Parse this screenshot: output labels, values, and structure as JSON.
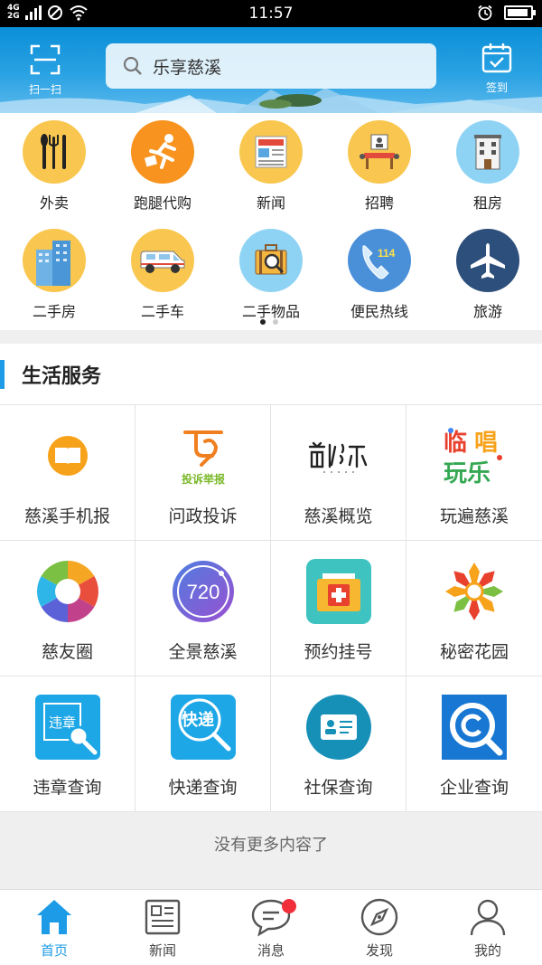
{
  "status_bar": {
    "network_top": "4G",
    "network_bottom": "2G",
    "time": "11:57",
    "battery_level": 0.85
  },
  "header": {
    "scan_label": "扫一扫",
    "search_text": "乐享慈溪",
    "checkin_label": "签到"
  },
  "quick_items": [
    {
      "label": "外卖",
      "icon": "food-icon",
      "color": "#f9c74f"
    },
    {
      "label": "跑腿代购",
      "icon": "runner-icon",
      "color": "#f7931e"
    },
    {
      "label": "新闻",
      "icon": "newspaper-icon",
      "color": "#f9c74f"
    },
    {
      "label": "招聘",
      "icon": "recruit-icon",
      "color": "#f9c74f"
    },
    {
      "label": "租房",
      "icon": "building-icon",
      "color": "#8fd3f4"
    },
    {
      "label": "二手房",
      "icon": "apartment-icon",
      "color": "#f9c74f"
    },
    {
      "label": "二手车",
      "icon": "van-icon",
      "color": "#f9c74f"
    },
    {
      "label": "二手物品",
      "icon": "suitcase-icon",
      "color": "#8fd3f4"
    },
    {
      "label": "便民热线",
      "icon": "phone-icon",
      "color": "#4a90d9"
    },
    {
      "label": "旅游",
      "icon": "airplane-icon",
      "color": "#2d4f7c"
    }
  ],
  "pager": {
    "total": 2,
    "active": 0
  },
  "section": {
    "title": "生活服务"
  },
  "services": [
    {
      "label": "慈溪手机报",
      "icon": "book-icon"
    },
    {
      "label": "问政投诉",
      "icon": "complaint-logo-icon",
      "logo_text": "投诉举报"
    },
    {
      "label": "慈溪概览",
      "icon": "cixi-logo-icon"
    },
    {
      "label": "玩遍慈溪",
      "icon": "play-logo-icon",
      "logo_text": "玩乐"
    },
    {
      "label": "慈友圈",
      "icon": "camera-aperture-icon"
    },
    {
      "label": "全景慈溪",
      "icon": "panorama-icon",
      "logo_text": "720"
    },
    {
      "label": "预约挂号",
      "icon": "medical-kit-icon"
    },
    {
      "label": "秘密花园",
      "icon": "flower-icon"
    },
    {
      "label": "违章查询",
      "icon": "violation-search-icon",
      "logo_text": "违章"
    },
    {
      "label": "快递查询",
      "icon": "express-search-icon",
      "logo_text": "快递"
    },
    {
      "label": "社保查询",
      "icon": "id-card-icon"
    },
    {
      "label": "企业查询",
      "icon": "enterprise-search-icon"
    }
  ],
  "footer_text": "没有更多内容了",
  "nav": [
    {
      "label": "首页",
      "icon": "home-icon",
      "active": true
    },
    {
      "label": "新闻",
      "icon": "news-icon",
      "active": false
    },
    {
      "label": "消息",
      "icon": "message-icon",
      "active": false,
      "badge": true
    },
    {
      "label": "发现",
      "icon": "compass-icon",
      "active": false
    },
    {
      "label": "我的",
      "icon": "user-icon",
      "active": false
    }
  ],
  "colors": {
    "accent": "#1e9be6",
    "badge": "#f02f3b",
    "header": "#1e9be6"
  }
}
